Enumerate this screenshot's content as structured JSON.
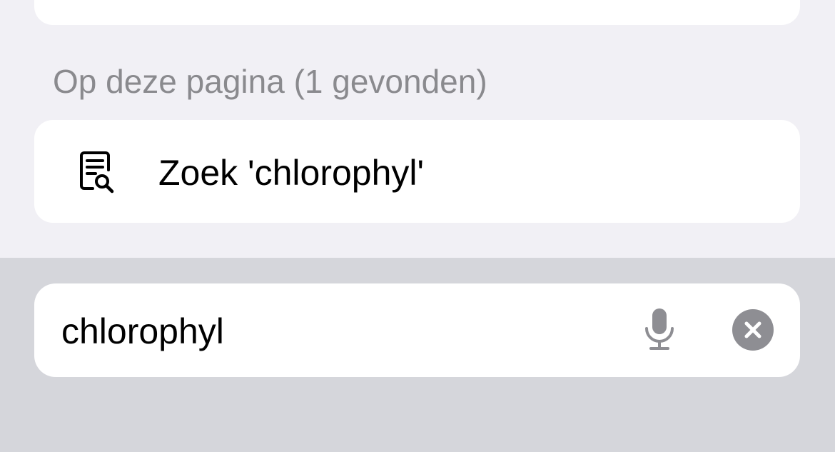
{
  "results": {
    "section_header": "Op deze pagina (1 gevonden)",
    "find_on_page": {
      "icon": "document-search-icon",
      "label": "Zoek 'chlorophyl'"
    }
  },
  "search": {
    "value": "chlorophyl",
    "mic_icon": "microphone-icon",
    "clear_icon": "clear-circle-x-icon"
  },
  "colors": {
    "background": "#f1f0f5",
    "bottom_bar": "#d5d6db",
    "card": "#ffffff",
    "secondary_text": "#8a8a8e",
    "icon_gray": "#8e8e93"
  }
}
